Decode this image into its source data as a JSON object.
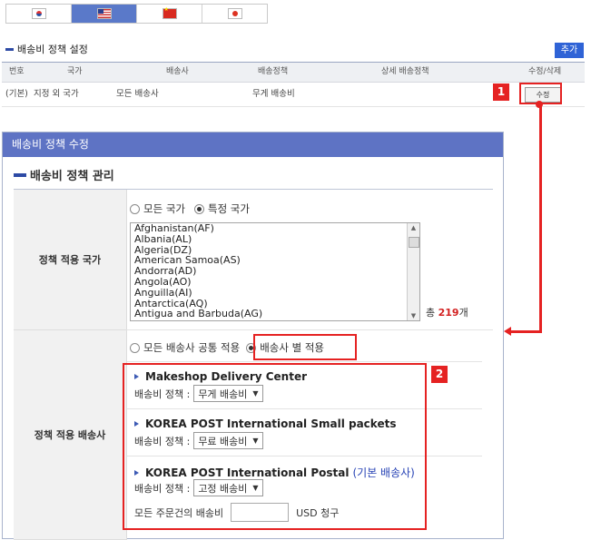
{
  "tabs": [
    {
      "flag": "korea-flag-icon"
    },
    {
      "flag": "usa-flag-icon"
    },
    {
      "flag": "china-flag-icon"
    },
    {
      "flag": "japan-flag-icon"
    }
  ],
  "section_title": "배송비 정책 설정",
  "add_label": "추가",
  "table": {
    "headers": [
      "번호",
      "국가",
      "배송사",
      "배송정책",
      "상세 배송정책",
      "수정/삭제"
    ],
    "row": {
      "no": "(기본)",
      "country": "지정 외 국가",
      "carrier": "모든 배송사",
      "policy": "무게 배송비",
      "edit": "수정"
    }
  },
  "badges": {
    "one": "1",
    "two": "2"
  },
  "popup": {
    "title": "배송비 정책 수정",
    "subtitle": "배송비 정책 관리",
    "country_label": "정책 적용 국가",
    "all_countries": "모든 국가",
    "specific_countries": "특정 국가",
    "countries": [
      "Afghanistan(AF)",
      "Albania(AL)",
      "Algeria(DZ)",
      "American Samoa(AS)",
      "Andorra(AD)",
      "Angola(AO)",
      "Anguilla(AI)",
      "Antarctica(AQ)",
      "Antigua and Barbuda(AG)"
    ],
    "total_prefix": "총",
    "total_count": "219",
    "total_suffix": "개",
    "carrier_label": "정책 적용 배송사",
    "all_carriers": "모든 배송사 공통 적용",
    "per_carrier": "배송사 별 적용",
    "policy_prefix": "배송비 정책 :",
    "carriers": [
      {
        "name": "Makeshop Delivery Center",
        "tag": "",
        "policy": "무게 배송비"
      },
      {
        "name": "KOREA POST International Small packets",
        "tag": "",
        "policy": "무료 배송비"
      },
      {
        "name": "KOREA POST International Postal",
        "tag": "(기본 배송사)",
        "policy": "고정 배송비"
      }
    ],
    "all_orders_label": "모든 주문건의 배송비",
    "all_orders_value": "",
    "usd_suffix": "USD 청구"
  },
  "colors": {
    "highlight": "#e52222",
    "title_bar": "#5e73c4",
    "add_button": "#2f63d6",
    "count": "#d32020"
  }
}
